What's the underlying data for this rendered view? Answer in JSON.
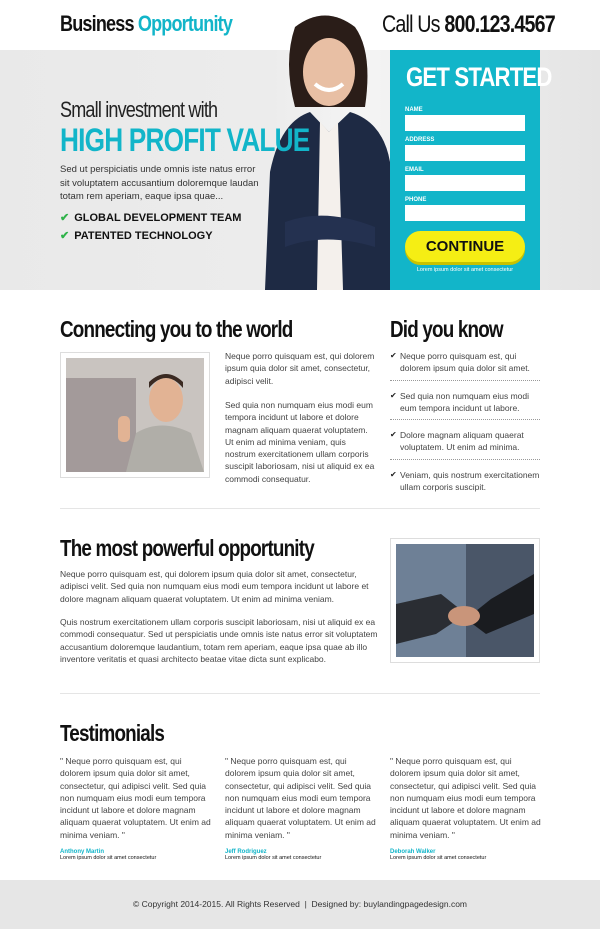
{
  "header": {
    "logo_part1": "Business",
    "logo_part2": "Opportunity",
    "call_label": "Call Us",
    "phone": "800.123.4567"
  },
  "hero": {
    "subtitle": "Small investment with",
    "headline": "HIGH PROFIT VALUE",
    "text": "Sed ut perspiciatis unde omnis iste natus error sit voluptatem accusantium doloremque laudan totam rem aperiam, eaque ipsa quae...",
    "features": [
      "GLOBAL DEVELOPMENT TEAM",
      "PATENTED TECHNOLOGY"
    ]
  },
  "form": {
    "title": "GET STARTED",
    "fields": [
      "NAME",
      "ADDRESS",
      "EMAIL",
      "PHONE"
    ],
    "button": "CONTINUE",
    "note": "Lorem ipsum dolor sit amet consectetur",
    "accent": "#12b5c9",
    "button_color": "#f5ee14"
  },
  "connecting": {
    "title": "Connecting you to the world",
    "p1": "Neque porro quisquam est, qui dolorem ipsum quia dolor sit amet, consectetur, adipisci velit.",
    "p2": "Sed quia non numquam eius modi eum tempora incidunt ut labore et dolore magnam aliquam quaerat voluptatem. Ut enim ad minima veniam, quis nostrum exercitationem ullam corporis suscipit laboriosam, nisi ut aliquid ex ea commodi consequatur."
  },
  "did_you_know": {
    "title": "Did you know",
    "items": [
      "Neque porro quisquam est, qui dolorem ipsum quia dolor sit amet.",
      "Sed quia non numquam eius modi eum tempora incidunt ut labore.",
      "Dolore magnam aliquam quaerat voluptatem. Ut enim ad minima.",
      "Veniam, quis nostrum exercitationem ullam corporis suscipit."
    ]
  },
  "opportunity": {
    "title": "The most powerful opportunity",
    "p1": "Neque porro quisquam est, qui dolorem ipsum quia dolor sit amet, consectetur, adipisci velit. Sed quia non numquam eius modi eum tempora incidunt ut labore et dolore magnam aliquam quaerat voluptatem. Ut enim ad minima veniam.",
    "p2": "Quis nostrum exercitationem ullam corporis suscipit laboriosam, nisi ut aliquid ex ea commodi consequatur. Sed ut perspiciatis unde omnis iste natus error sit voluptatem accusantium doloremque laudantium, totam rem aperiam, eaque ipsa quae ab illo inventore veritatis et quasi architecto beatae vitae dicta sunt explicabo."
  },
  "testimonials": {
    "title": "Testimonials",
    "items": [
      {
        "quote": "\" Neque porro quisquam est, qui dolorem ipsum quia dolor sit amet, consectetur, qui adipisci velit. Sed quia non numquam eius modi eum tempora incidunt ut labore et dolore magnam aliquam quaerat voluptatem. Ut enim ad minima veniam. \"",
        "name": "Anthony Martin",
        "role": "Lorem ipsum dolor sit amet consectetur"
      },
      {
        "quote": "\" Neque porro quisquam est, qui dolorem ipsum quia dolor sit amet, consectetur, qui adipisci velit. Sed quia non numquam eius modi eum tempora incidunt ut labore et dolore magnam aliquam quaerat voluptatem. Ut enim ad minima veniam. \"",
        "name": "Jeff Rodriguez",
        "role": "Lorem ipsum dolor sit amet consectetur"
      },
      {
        "quote": "\" Neque porro quisquam est, qui dolorem ipsum quia dolor sit amet, consectetur, qui adipisci velit. Sed quia non numquam eius modi eum tempora incidunt ut labore et dolore magnam aliquam quaerat voluptatem. Ut enim ad minima veniam. \"",
        "name": "Deborah Walker",
        "role": "Lorem ipsum dolor sit amet consectetur"
      }
    ]
  },
  "footer": {
    "text": "© Copyright 2014-2015. All Rights Reserved  |  Designed by: buylandingpagedesign.com"
  }
}
